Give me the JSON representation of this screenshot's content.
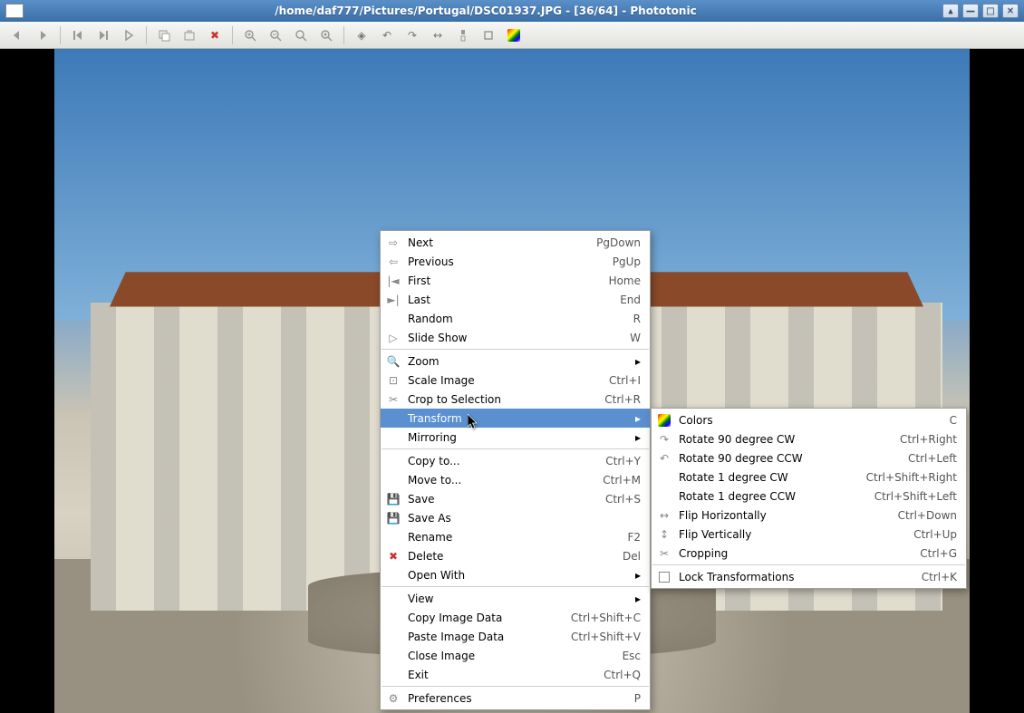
{
  "window": {
    "title": "/home/daf777/Pictures/Portugal/DSC01937.JPG - [36/64] - Phototonic"
  },
  "toolbar": {
    "back": "◄",
    "forward": "►",
    "first": "|◄",
    "prev": "◄|",
    "next": "►",
    "copy": "⿻",
    "move": "⿻",
    "delete": "✖",
    "zoomin": "🔍",
    "zoomout": "🔍",
    "zoom100": "🔍",
    "zoomfit": "🔍",
    "rot1": "◆",
    "rotccw": "↶",
    "rotcw": "↷",
    "flip": "↔",
    "crop1": "✂",
    "crop2": "⊡"
  },
  "menu": [
    {
      "icon": "⇨",
      "label": "Next",
      "shortcut": "PgDown"
    },
    {
      "icon": "⇦",
      "label": "Previous",
      "shortcut": "PgUp"
    },
    {
      "icon": "|◄",
      "label": "First",
      "shortcut": "Home"
    },
    {
      "icon": "►|",
      "label": "Last",
      "shortcut": "End"
    },
    {
      "icon": "",
      "label": "Random",
      "shortcut": "R"
    },
    {
      "icon": "▷",
      "label": "Slide Show",
      "shortcut": "W"
    },
    {
      "sep": true
    },
    {
      "icon": "🔍",
      "label": "Zoom",
      "submenu": true
    },
    {
      "icon": "⊡",
      "label": "Scale Image",
      "shortcut": "Ctrl+I"
    },
    {
      "icon": "✂",
      "label": "Crop to Selection",
      "shortcut": "Ctrl+R"
    },
    {
      "icon": "",
      "label": "Transform",
      "submenu": true,
      "highlight": true
    },
    {
      "icon": "",
      "label": "Mirroring",
      "submenu": true
    },
    {
      "sep": true
    },
    {
      "icon": "",
      "label": "Copy to...",
      "shortcut": "Ctrl+Y"
    },
    {
      "icon": "",
      "label": "Move to...",
      "shortcut": "Ctrl+M"
    },
    {
      "icon": "💾",
      "label": "Save",
      "shortcut": "Ctrl+S"
    },
    {
      "icon": "💾",
      "label": "Save As",
      "shortcut": ""
    },
    {
      "icon": "",
      "label": "Rename",
      "shortcut": "F2"
    },
    {
      "icon": "✖",
      "label": "Delete",
      "shortcut": "Del",
      "iconcolor": "#c33"
    },
    {
      "icon": "",
      "label": "Open With",
      "submenu": true
    },
    {
      "sep": true
    },
    {
      "icon": "",
      "label": "View",
      "submenu": true
    },
    {
      "icon": "",
      "label": "Copy Image Data",
      "shortcut": "Ctrl+Shift+C"
    },
    {
      "icon": "",
      "label": "Paste Image Data",
      "shortcut": "Ctrl+Shift+V"
    },
    {
      "icon": "",
      "label": "Close Image",
      "shortcut": "Esc"
    },
    {
      "icon": "",
      "label": "Exit",
      "shortcut": "Ctrl+Q"
    },
    {
      "sep": true
    },
    {
      "icon": "⚙",
      "label": "Preferences",
      "shortcut": "P"
    }
  ],
  "submenu": [
    {
      "icon": "rainbow",
      "label": "Colors",
      "shortcut": "C"
    },
    {
      "icon": "↷",
      "label": "Rotate 90 degree CW",
      "shortcut": "Ctrl+Right"
    },
    {
      "icon": "↶",
      "label": "Rotate 90 degree CCW",
      "shortcut": "Ctrl+Left"
    },
    {
      "icon": "",
      "label": "Rotate 1 degree CW",
      "shortcut": "Ctrl+Shift+Right"
    },
    {
      "icon": "",
      "label": "Rotate 1 degree CCW",
      "shortcut": "Ctrl+Shift+Left"
    },
    {
      "icon": "↔",
      "label": "Flip Horizontally",
      "shortcut": "Ctrl+Down"
    },
    {
      "icon": "↕",
      "label": "Flip Vertically",
      "shortcut": "Ctrl+Up"
    },
    {
      "icon": "✂",
      "label": "Cropping",
      "shortcut": "Ctrl+G"
    },
    {
      "sep": true
    },
    {
      "icon": "checkbox",
      "label": "Lock Transformations",
      "shortcut": "Ctrl+K"
    }
  ]
}
